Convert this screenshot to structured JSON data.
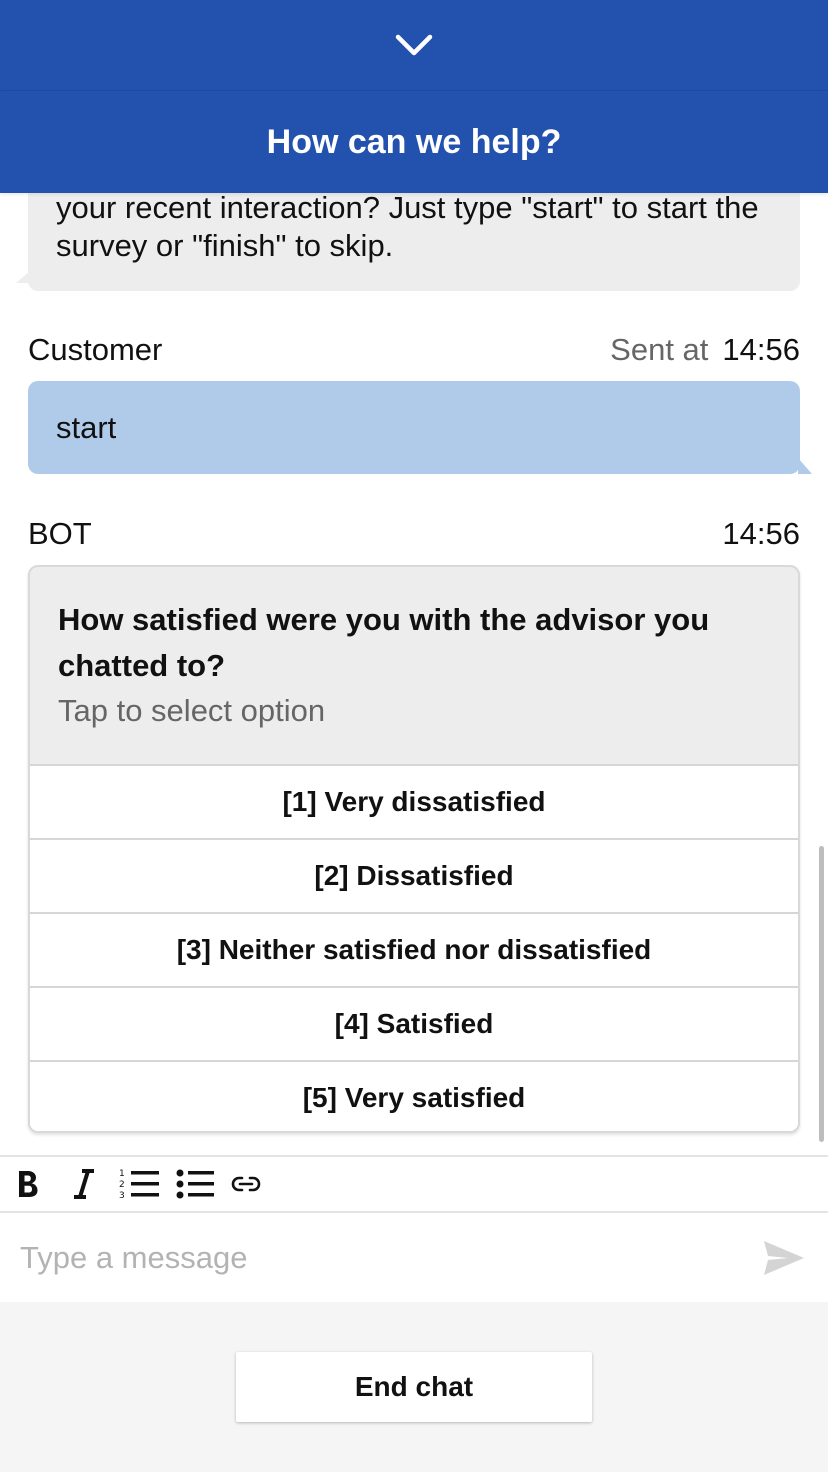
{
  "header": {
    "collapse_icon": "chevron-down-icon",
    "title": "How can we help?"
  },
  "messages": {
    "previous_bot_text": "your recent interaction? Just type \"start\" to start the survey or \"finish\" to skip.",
    "customer": {
      "sender": "Customer",
      "sent_label": "Sent at",
      "time": "14:56",
      "text": "start"
    },
    "bot": {
      "sender": "BOT",
      "time": "14:56",
      "question": "How satisfied were you with the advisor you chatted to?",
      "hint": "Tap to select option",
      "options": [
        "[1] Very dissatisfied",
        "[2] Dissatisfied",
        "[3] Neither satisfied nor dissatisfied",
        "[4] Satisfied",
        "[5] Very satisfied"
      ]
    }
  },
  "toolbar": {
    "icons": [
      "bold-icon",
      "italic-icon",
      "numbered-list-icon",
      "bulleted-list-icon",
      "link-icon"
    ]
  },
  "composer": {
    "placeholder": "Type a message",
    "send_icon": "send-icon"
  },
  "footer": {
    "end_chat_label": "End chat"
  },
  "colors": {
    "brand": "#2251ae",
    "customer_bubble": "#b0cbea",
    "bot_bubble": "#ededed"
  }
}
